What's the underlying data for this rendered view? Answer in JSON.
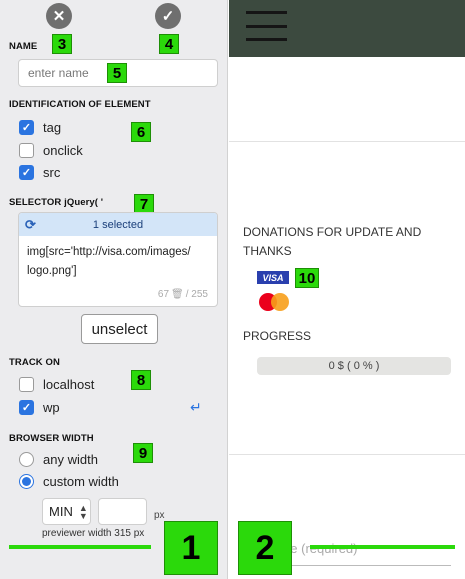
{
  "toolbar": {
    "close_icon": "close-icon",
    "confirm_icon": "check-icon"
  },
  "badges": {
    "b1": "1",
    "b2": "2",
    "b3": "3",
    "b4": "4",
    "b5": "5",
    "b6": "6",
    "b7": "7",
    "b8": "8",
    "b9": "9",
    "b10": "10"
  },
  "name_section": {
    "label": "NAME",
    "placeholder": "enter name"
  },
  "identification": {
    "label": "IDENTIFICATION OF ELEMENT",
    "options": [
      {
        "label": "tag",
        "checked": true
      },
      {
        "label": "onclick",
        "checked": false
      },
      {
        "label": "src",
        "checked": true
      }
    ]
  },
  "selector": {
    "label": "SELECTOR jQuery( '",
    "selected_text": "1 selected",
    "value_line1": "img[src='http://visa.com/images/",
    "value_line2": "logo.png']",
    "count": "67",
    "max": "/ 255"
  },
  "unselect_label": "unselect",
  "track_on": {
    "label": "TRACK ON",
    "options": [
      {
        "label": "localhost",
        "checked": false
      },
      {
        "label": "wp",
        "checked": true
      }
    ]
  },
  "browser_width": {
    "label": "BROWSER WIDTH",
    "options": [
      {
        "label": "any width",
        "selected": false
      },
      {
        "label": "custom width",
        "selected": true
      }
    ],
    "min_value": "MIN",
    "px_label": "px",
    "previewer_text": "previewer width 315 px"
  },
  "site": {
    "donations_title": "DONATIONS FOR UPDATE AND THANKS",
    "visa_text": "VISA",
    "progress_label": "PROGRESS",
    "progress_text": "0 $ ( 0 % )",
    "progress_fraction": 0,
    "name_placeholder": "name (required)"
  },
  "colors": {
    "accent": "#2b74e0",
    "badge": "#2bd90b",
    "topbar": "#3c4a3f"
  }
}
